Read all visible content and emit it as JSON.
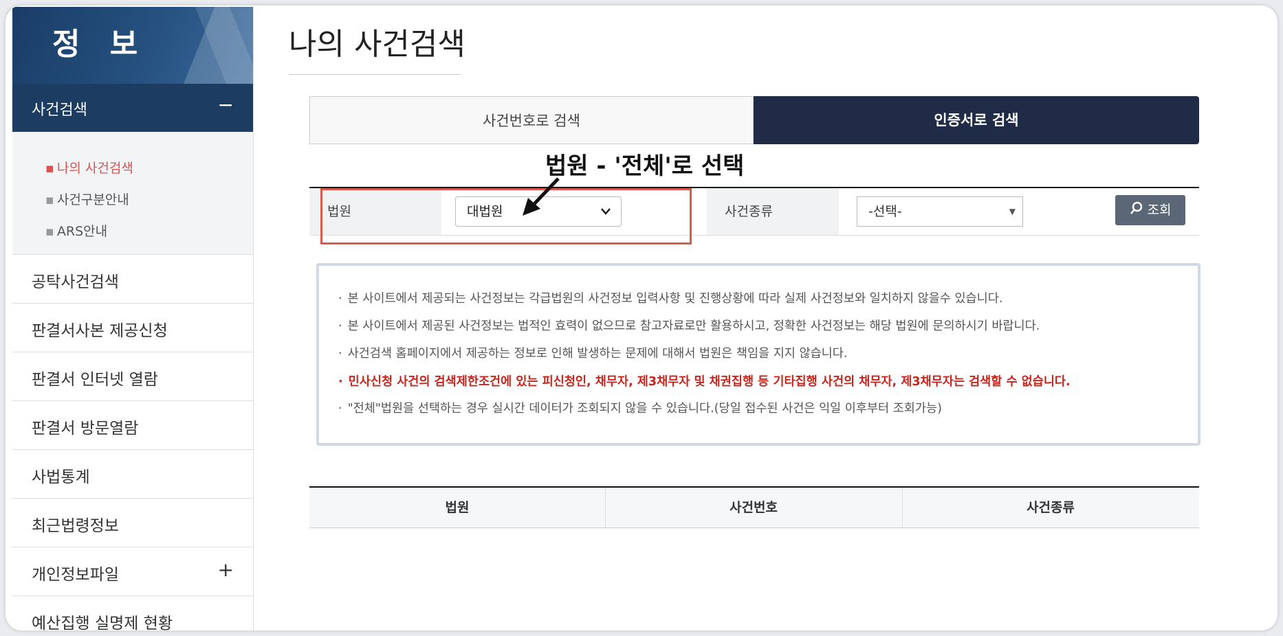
{
  "sidebar": {
    "title": "정 보",
    "active_menu": {
      "label": "사건검색",
      "toggle": "−"
    },
    "submenu": [
      {
        "label": "나의 사건검색",
        "active": true
      },
      {
        "label": "사건구분안내",
        "active": false
      },
      {
        "label": "ARS안내",
        "active": false
      }
    ],
    "menu": [
      {
        "label": "공탁사건검색"
      },
      {
        "label": "판결서사본 제공신청"
      },
      {
        "label": "판결서 인터넷 열람"
      },
      {
        "label": "판결서 방문열람"
      },
      {
        "label": "사법통계"
      },
      {
        "label": "최근법령정보"
      },
      {
        "label": "개인정보파일",
        "toggle": "+"
      },
      {
        "label": "예산집행 실명제 현황"
      }
    ]
  },
  "main": {
    "page_title": "나의 사건검색",
    "tabs": [
      {
        "label": "사건번호로 검색",
        "active": false
      },
      {
        "label": "인증서로 검색",
        "active": true
      }
    ],
    "annotation": "법원 - '전체'로 선택",
    "form": {
      "court_label": "법원",
      "court_value": "대법원",
      "type_label": "사건종류",
      "type_value": "-선택-",
      "search_button": "조회"
    },
    "notices": [
      {
        "text": "본 사이트에서 제공되는 사건정보는 각급법원의 사건정보 입력사항 및 진행상황에 따라 실제 사건정보와 일치하지 않을수 있습니다.",
        "emphasis": false
      },
      {
        "text": "본 사이트에서 제공된 사건정보는 법적인 효력이 없으므로 참고자료로만 활용하시고, 정확한 사건정보는 해당 법원에 문의하시기 바랍니다.",
        "emphasis": false
      },
      {
        "text": "사건검색 홈페이지에서 제공하는 정보로 인해 발생하는 문제에 대해서 법원은 책임을 지지 않습니다.",
        "emphasis": false
      },
      {
        "text": "민사신청 사건의 검색제한조건에 있는 피신청인, 채무자, 제3채무자 및 채권집행 등 기타집행 사건의 채무자, 제3채무자는 검색할 수 없습니다.",
        "emphasis": true
      },
      {
        "text": "\"전체\"법원을 선택하는 경우 실시간 데이터가 조회되지 않을 수 있습니다.(당일 접수된 사건은 익일 이후부터 조회가능)",
        "emphasis": false
      }
    ],
    "table_headers": [
      "법원",
      "사건번호",
      "사건종류"
    ]
  },
  "colors": {
    "sidebar_active": "#1c3c62",
    "tab_active": "#1f2b47",
    "highlight": "#d85a4a",
    "notice_red": "#c7251c"
  }
}
